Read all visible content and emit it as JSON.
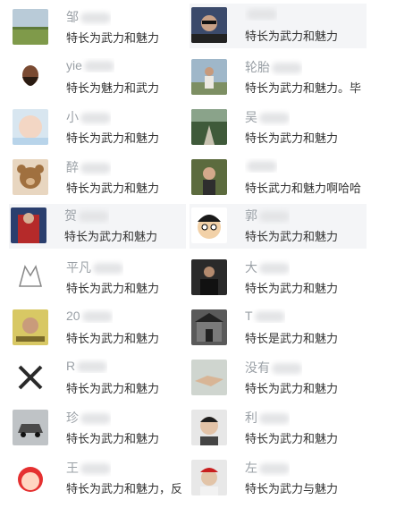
{
  "friends": [
    {
      "name": "邹",
      "desc": "特长为武力和魅力",
      "avatar": "field-landscape-avatar"
    },
    {
      "name": "",
      "desc": "特长为武力和魅力",
      "avatar": "man-sunglasses-avatar"
    },
    {
      "name": "yie",
      "desc": "特长为魅力和武力",
      "avatar": "bearded-man-avatar"
    },
    {
      "name": "轮胎",
      "desc": "特长为武力和魅力。毕",
      "avatar": "man-outdoors-avatar"
    },
    {
      "name": "小",
      "desc": "特长为武力和魅力",
      "avatar": "baby-avatar"
    },
    {
      "name": "吴",
      "desc": "特长为武力和魅力",
      "avatar": "tree-path-avatar"
    },
    {
      "name": "醉",
      "desc": "特长为武力和魅力",
      "avatar": "teddy-bear-avatar"
    },
    {
      "name": "",
      "desc": "特长武力和魅力啊哈哈",
      "avatar": "child-outdoors-avatar"
    },
    {
      "name": "贺",
      "desc": "特长为武力和魅力",
      "avatar": "superhero-avatar"
    },
    {
      "name": "郭",
      "desc": "特长为武力和魅力",
      "avatar": "cartoon-face-avatar"
    },
    {
      "name": "平凡",
      "desc": "特长为武力和魅力",
      "avatar": "sketch-cat-avatar"
    },
    {
      "name": "大",
      "desc": "特长为武力和魅力",
      "avatar": "man-dark-suit-avatar"
    },
    {
      "name": "20",
      "desc": "特长为武力和魅力",
      "avatar": "poster-avatar"
    },
    {
      "name": "T",
      "desc": "特长是武力和魅力",
      "avatar": "gate-building-avatar"
    },
    {
      "name": "R",
      "desc": "特长为武力和魅力",
      "avatar": "crossed-x-avatar"
    },
    {
      "name": "没有",
      "desc": "特长为武力和魅力",
      "avatar": "handshake-avatar"
    },
    {
      "name": "珍",
      "desc": "特长为武力和魅力",
      "avatar": "car-avatar"
    },
    {
      "name": "利",
      "desc": "特长为武力和魅力",
      "avatar": "young-man-avatar"
    },
    {
      "name": "王",
      "desc": "特长为武力和魅力，反",
      "avatar": "cartoon-girl-avatar"
    },
    {
      "name": "左",
      "desc": "特长为武力与魅力",
      "avatar": "man-red-cap-avatar"
    }
  ],
  "colors": {
    "highlight_row": "#f4f5f7",
    "name_text": "#9aa0a6",
    "desc_text": "#333333"
  }
}
